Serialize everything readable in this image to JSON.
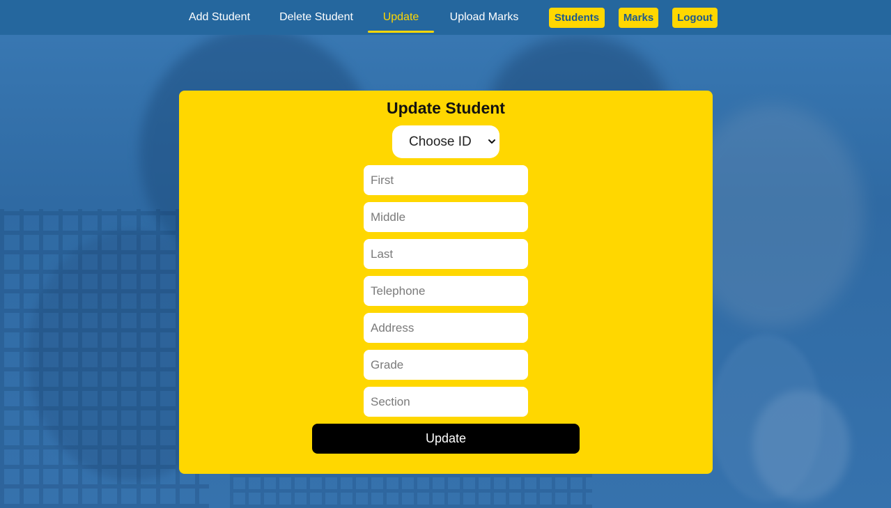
{
  "nav": {
    "links": [
      {
        "label": "Add Student"
      },
      {
        "label": "Delete Student"
      },
      {
        "label": "Update"
      },
      {
        "label": "Upload Marks"
      }
    ],
    "buttons": [
      {
        "label": "Students"
      },
      {
        "label": "Marks"
      },
      {
        "label": "Logout"
      }
    ]
  },
  "form": {
    "title": "Update Student",
    "select": {
      "selected": "Choose ID"
    },
    "fields": [
      {
        "placeholder": "First"
      },
      {
        "placeholder": "Middle"
      },
      {
        "placeholder": "Last"
      },
      {
        "placeholder": "Telephone"
      },
      {
        "placeholder": "Address"
      },
      {
        "placeholder": "Grade"
      },
      {
        "placeholder": "Section"
      }
    ],
    "submit_label": "Update"
  },
  "colors": {
    "accent": "#ffd700",
    "nav_bg": "#25679e",
    "button_text": "#1f5a8c",
    "submit_bg": "#000000"
  },
  "icons": {
    "select_chevron": "chevron-down-icon"
  }
}
